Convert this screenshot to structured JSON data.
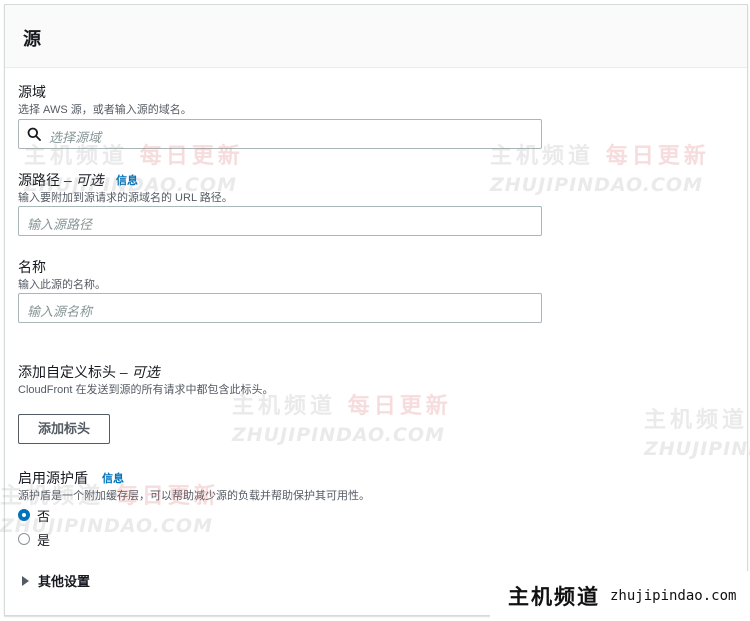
{
  "panel": {
    "title": "源"
  },
  "origin_domain": {
    "label": "源域",
    "description": "选择 AWS 源，或者输入源的域名。",
    "placeholder": "选择源域"
  },
  "origin_path": {
    "label": "源路径",
    "optional": " – 可选",
    "info": "信息",
    "description": "输入要附加到源请求的源域名的 URL 路径。",
    "placeholder": "输入源路径"
  },
  "name": {
    "label": "名称",
    "description": "输入此源的名称。",
    "placeholder": "输入源名称"
  },
  "custom_header": {
    "label": "添加自定义标头",
    "optional": " – 可选",
    "description": "CloudFront 在发送到源的所有请求中都包含此标头。",
    "button": "添加标头"
  },
  "origin_shield": {
    "label": "启用源护盾",
    "info": "信息",
    "description": "源护盾是一个附加缓存层，可以帮助减少源的负载并帮助保护其可用性。",
    "options": [
      {
        "label": "否",
        "checked": true
      },
      {
        "label": "是",
        "checked": false
      }
    ]
  },
  "additional_settings": {
    "label": "其他设置"
  },
  "watermark": {
    "cn_a": "主机频道",
    "cn_b": "每日更新",
    "en": "ZHUJIPINDAO.COM"
  },
  "brand": {
    "name": "主机频道",
    "url": "zhujipindao.com"
  },
  "colors": {
    "accent": "#0073bb",
    "border": "#aab7b8",
    "text": "#16191f",
    "muted": "#545b64"
  },
  "icons": {
    "search": "search-icon",
    "caret": "caret-right-icon"
  }
}
